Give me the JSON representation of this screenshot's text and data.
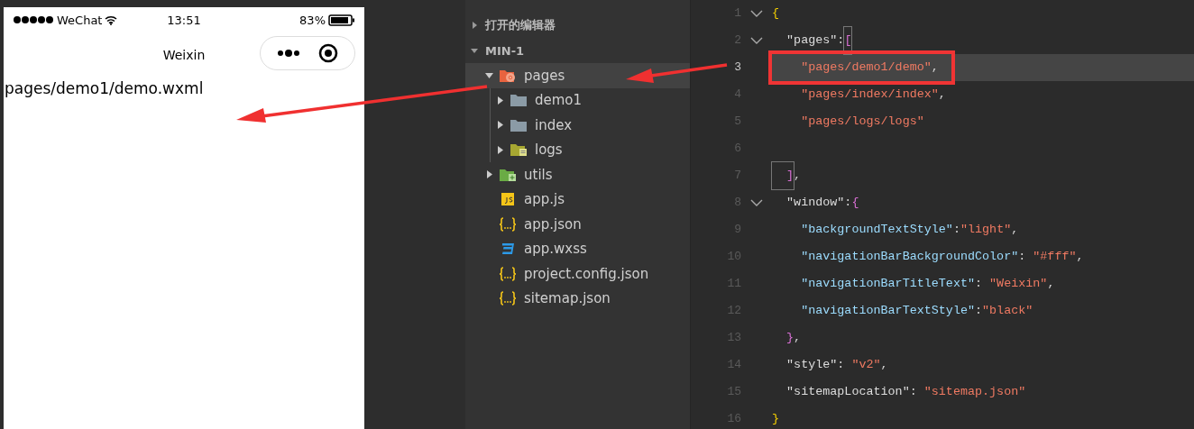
{
  "simulator": {
    "status_bar": {
      "carrier": "WeChat",
      "time": "13:51",
      "battery": "83%"
    },
    "nav_title": "Weixin",
    "page_text": "pages/demo1/demo.wxml"
  },
  "explorer": {
    "sections": [
      {
        "label": "打开的编辑器",
        "expanded": false
      },
      {
        "label": "MIN-1",
        "expanded": true,
        "items": [
          {
            "name": "pages",
            "kind": "pages-folder",
            "expanded": true,
            "selected": true,
            "children": [
              {
                "name": "demo1",
                "kind": "folder",
                "expanded": false,
                "selected": false
              },
              {
                "name": "index",
                "kind": "folder",
                "expanded": false,
                "selected": false
              },
              {
                "name": "logs",
                "kind": "logs-folder",
                "expanded": false,
                "selected": false
              }
            ]
          },
          {
            "name": "utils",
            "kind": "utils-folder",
            "expanded": false,
            "selected": false
          },
          {
            "name": "app.js",
            "kind": "js",
            "selected": false
          },
          {
            "name": "app.json",
            "kind": "json",
            "selected": false
          },
          {
            "name": "app.wxss",
            "kind": "css",
            "selected": false
          },
          {
            "name": "project.config.json",
            "kind": "json",
            "selected": false
          },
          {
            "name": "sitemap.json",
            "kind": "json",
            "selected": false
          }
        ]
      }
    ]
  },
  "editor": {
    "lines": [
      {
        "number": "1",
        "fold": true,
        "current": false,
        "annotated": false,
        "tokens": [
          {
            "kind": "brace-outer",
            "text": "{"
          }
        ]
      },
      {
        "number": "2",
        "fold": true,
        "current": false,
        "annotated": false,
        "tokens": [
          {
            "kind": "prop",
            "text": "  \"pages\""
          },
          {
            "kind": "punct",
            "text": ":"
          },
          {
            "kind": "bracket-match",
            "text": "["
          }
        ]
      },
      {
        "number": "3",
        "fold": false,
        "current": true,
        "annotated": true,
        "tokens": [
          {
            "kind": "string",
            "text": "    \"pages/demo1/demo\""
          },
          {
            "kind": "punct",
            "text": ","
          }
        ]
      },
      {
        "number": "4",
        "fold": false,
        "current": false,
        "annotated": false,
        "tokens": [
          {
            "kind": "string",
            "text": "    \"pages/index/index\""
          },
          {
            "kind": "punct",
            "text": ","
          }
        ]
      },
      {
        "number": "5",
        "fold": false,
        "current": false,
        "annotated": false,
        "tokens": [
          {
            "kind": "string",
            "text": "    \"pages/logs/logs\""
          }
        ]
      },
      {
        "number": "6",
        "fold": false,
        "current": false,
        "annotated": false
      },
      {
        "number": "7",
        "fold": false,
        "current": false,
        "annotated": false,
        "tokens": [
          {
            "kind": "bracket-match",
            "text": "  ]"
          },
          {
            "kind": "punct",
            "text": ","
          }
        ]
      },
      {
        "number": "8",
        "fold": true,
        "current": false,
        "annotated": false,
        "tokens": [
          {
            "kind": "prop",
            "text": "  \"window\""
          },
          {
            "kind": "punct",
            "text": ":"
          },
          {
            "kind": "brace-inner",
            "text": "{"
          }
        ]
      },
      {
        "number": "9",
        "fold": false,
        "current": false,
        "annotated": false,
        "tokens": [
          {
            "kind": "key",
            "text": "    \"backgroundTextStyle\""
          },
          {
            "kind": "punct",
            "text": ":"
          },
          {
            "kind": "string",
            "text": "\"light\""
          },
          {
            "kind": "punct",
            "text": ","
          }
        ]
      },
      {
        "number": "10",
        "fold": false,
        "current": false,
        "annotated": false,
        "tokens": [
          {
            "kind": "key",
            "text": "    \"navigationBarBackgroundColor\""
          },
          {
            "kind": "punct",
            "text": ": "
          },
          {
            "kind": "string",
            "text": "\"#fff\""
          },
          {
            "kind": "punct",
            "text": ","
          }
        ]
      },
      {
        "number": "11",
        "fold": false,
        "current": false,
        "annotated": false,
        "tokens": [
          {
            "kind": "key",
            "text": "    \"navigationBarTitleText\""
          },
          {
            "kind": "punct",
            "text": ": "
          },
          {
            "kind": "string",
            "text": "\"Weixin\""
          },
          {
            "kind": "punct",
            "text": ","
          }
        ]
      },
      {
        "number": "12",
        "fold": false,
        "current": false,
        "annotated": false,
        "tokens": [
          {
            "kind": "key",
            "text": "    \"navigationBarTextStyle\""
          },
          {
            "kind": "punct",
            "text": ":"
          },
          {
            "kind": "string",
            "text": "\"black\""
          }
        ]
      },
      {
        "number": "13",
        "fold": false,
        "current": false,
        "annotated": false,
        "tokens": [
          {
            "kind": "brace-inner",
            "text": "  }"
          },
          {
            "kind": "punct",
            "text": ","
          }
        ]
      },
      {
        "number": "14",
        "fold": false,
        "current": false,
        "annotated": false,
        "tokens": [
          {
            "kind": "prop",
            "text": "  \"style\""
          },
          {
            "kind": "punct",
            "text": ": "
          },
          {
            "kind": "string",
            "text": "\"v2\""
          },
          {
            "kind": "punct",
            "text": ","
          }
        ]
      },
      {
        "number": "15",
        "fold": false,
        "current": false,
        "annotated": false,
        "tokens": [
          {
            "kind": "prop",
            "text": "  \"sitemapLocation\""
          },
          {
            "kind": "punct",
            "text": ": "
          },
          {
            "kind": "string",
            "text": "\"sitemap.json\""
          }
        ]
      },
      {
        "number": "16",
        "fold": false,
        "current": false,
        "annotated": false,
        "tokens": [
          {
            "kind": "brace-outer",
            "text": "}"
          }
        ]
      }
    ]
  }
}
